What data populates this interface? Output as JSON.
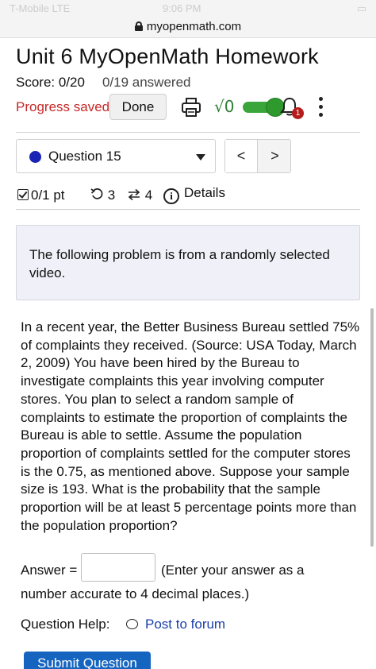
{
  "statusbar": {
    "carrier": "T-Mobile LTE",
    "time": "9:06 PM"
  },
  "browser": {
    "url": "myopenmath.com"
  },
  "header": {
    "title": "Unit 6 MyOpenMath Homework",
    "score": "Score: 0/20",
    "answered": "0/19 answered",
    "progress_saved": "Progress saved",
    "done_label": "Done",
    "sqrt_symbol": "√0",
    "notification_count": "1"
  },
  "question_nav": {
    "selected": "Question 15",
    "prev_label": "<",
    "next_label": ">"
  },
  "meta": {
    "points": "0/1 pt",
    "retries": "3",
    "attempts": "4",
    "details_label": "Details",
    "info_glyph": "i"
  },
  "intro": "The following problem is from a randomly selected video.",
  "problem": "In a recent year, the Better Business Bureau settled 75% of complaints they received. (Source: USA Today, March 2, 2009) You have been hired by the Bureau to investigate complaints this year involving computer stores. You plan to select a random sample of complaints to estimate the proportion of complaints the Bureau is able to settle. Assume the population proportion of complaints settled for the computer stores is the 0.75, as mentioned above. Suppose your sample size is 193. What is the probability that the sample proportion will be at least 5 percentage points more than the population proportion?",
  "answer": {
    "label": "Answer =",
    "value": "",
    "hint_line1": "(Enter your answer as a",
    "hint_line2": "number accurate to 4 decimal places.)"
  },
  "help": {
    "label": "Question Help:",
    "link": "Post to forum"
  },
  "submit_label": "Submit Question",
  "colors": {
    "accent_blue": "#1565c0",
    "saved_red": "#c62828",
    "toggle_green": "#2e9a2e",
    "badge_red": "#b71c1c",
    "question_dot": "#1a23b3"
  }
}
